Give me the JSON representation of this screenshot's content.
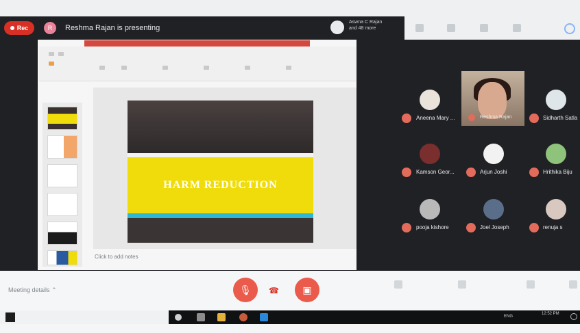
{
  "meet": {
    "rec_label": "Rec",
    "presenter_avatar_letter": "R",
    "presenting_text": "Reshma Rajan is presenting",
    "people_line1": "Aswna C Rajan",
    "people_line2": "and 48 more",
    "meeting_details": "Meeting details"
  },
  "presentation": {
    "slide_title": "HARM REDUCTION",
    "notes_placeholder": "Click to add notes"
  },
  "participants": [
    {
      "name": "Aneena Mary ..."
    },
    {
      "name": "Reshma Rajan"
    },
    {
      "name": "Sidharth Satla"
    },
    {
      "name": "Kamson Geor..."
    },
    {
      "name": "Arjun Joshi"
    },
    {
      "name": "Hrithika Biju"
    },
    {
      "name": "pooja kishore"
    },
    {
      "name": "Joel Joseph"
    },
    {
      "name": "renuja s"
    }
  ],
  "taskbar": {
    "lang": "ENG",
    "time": "12:52 PM"
  },
  "colors": {
    "meet_dark": "#202124",
    "danger_red": "#ea5b4b",
    "slide_yellow": "#f0dc0a",
    "slide_cyan": "#2fb7d5"
  }
}
